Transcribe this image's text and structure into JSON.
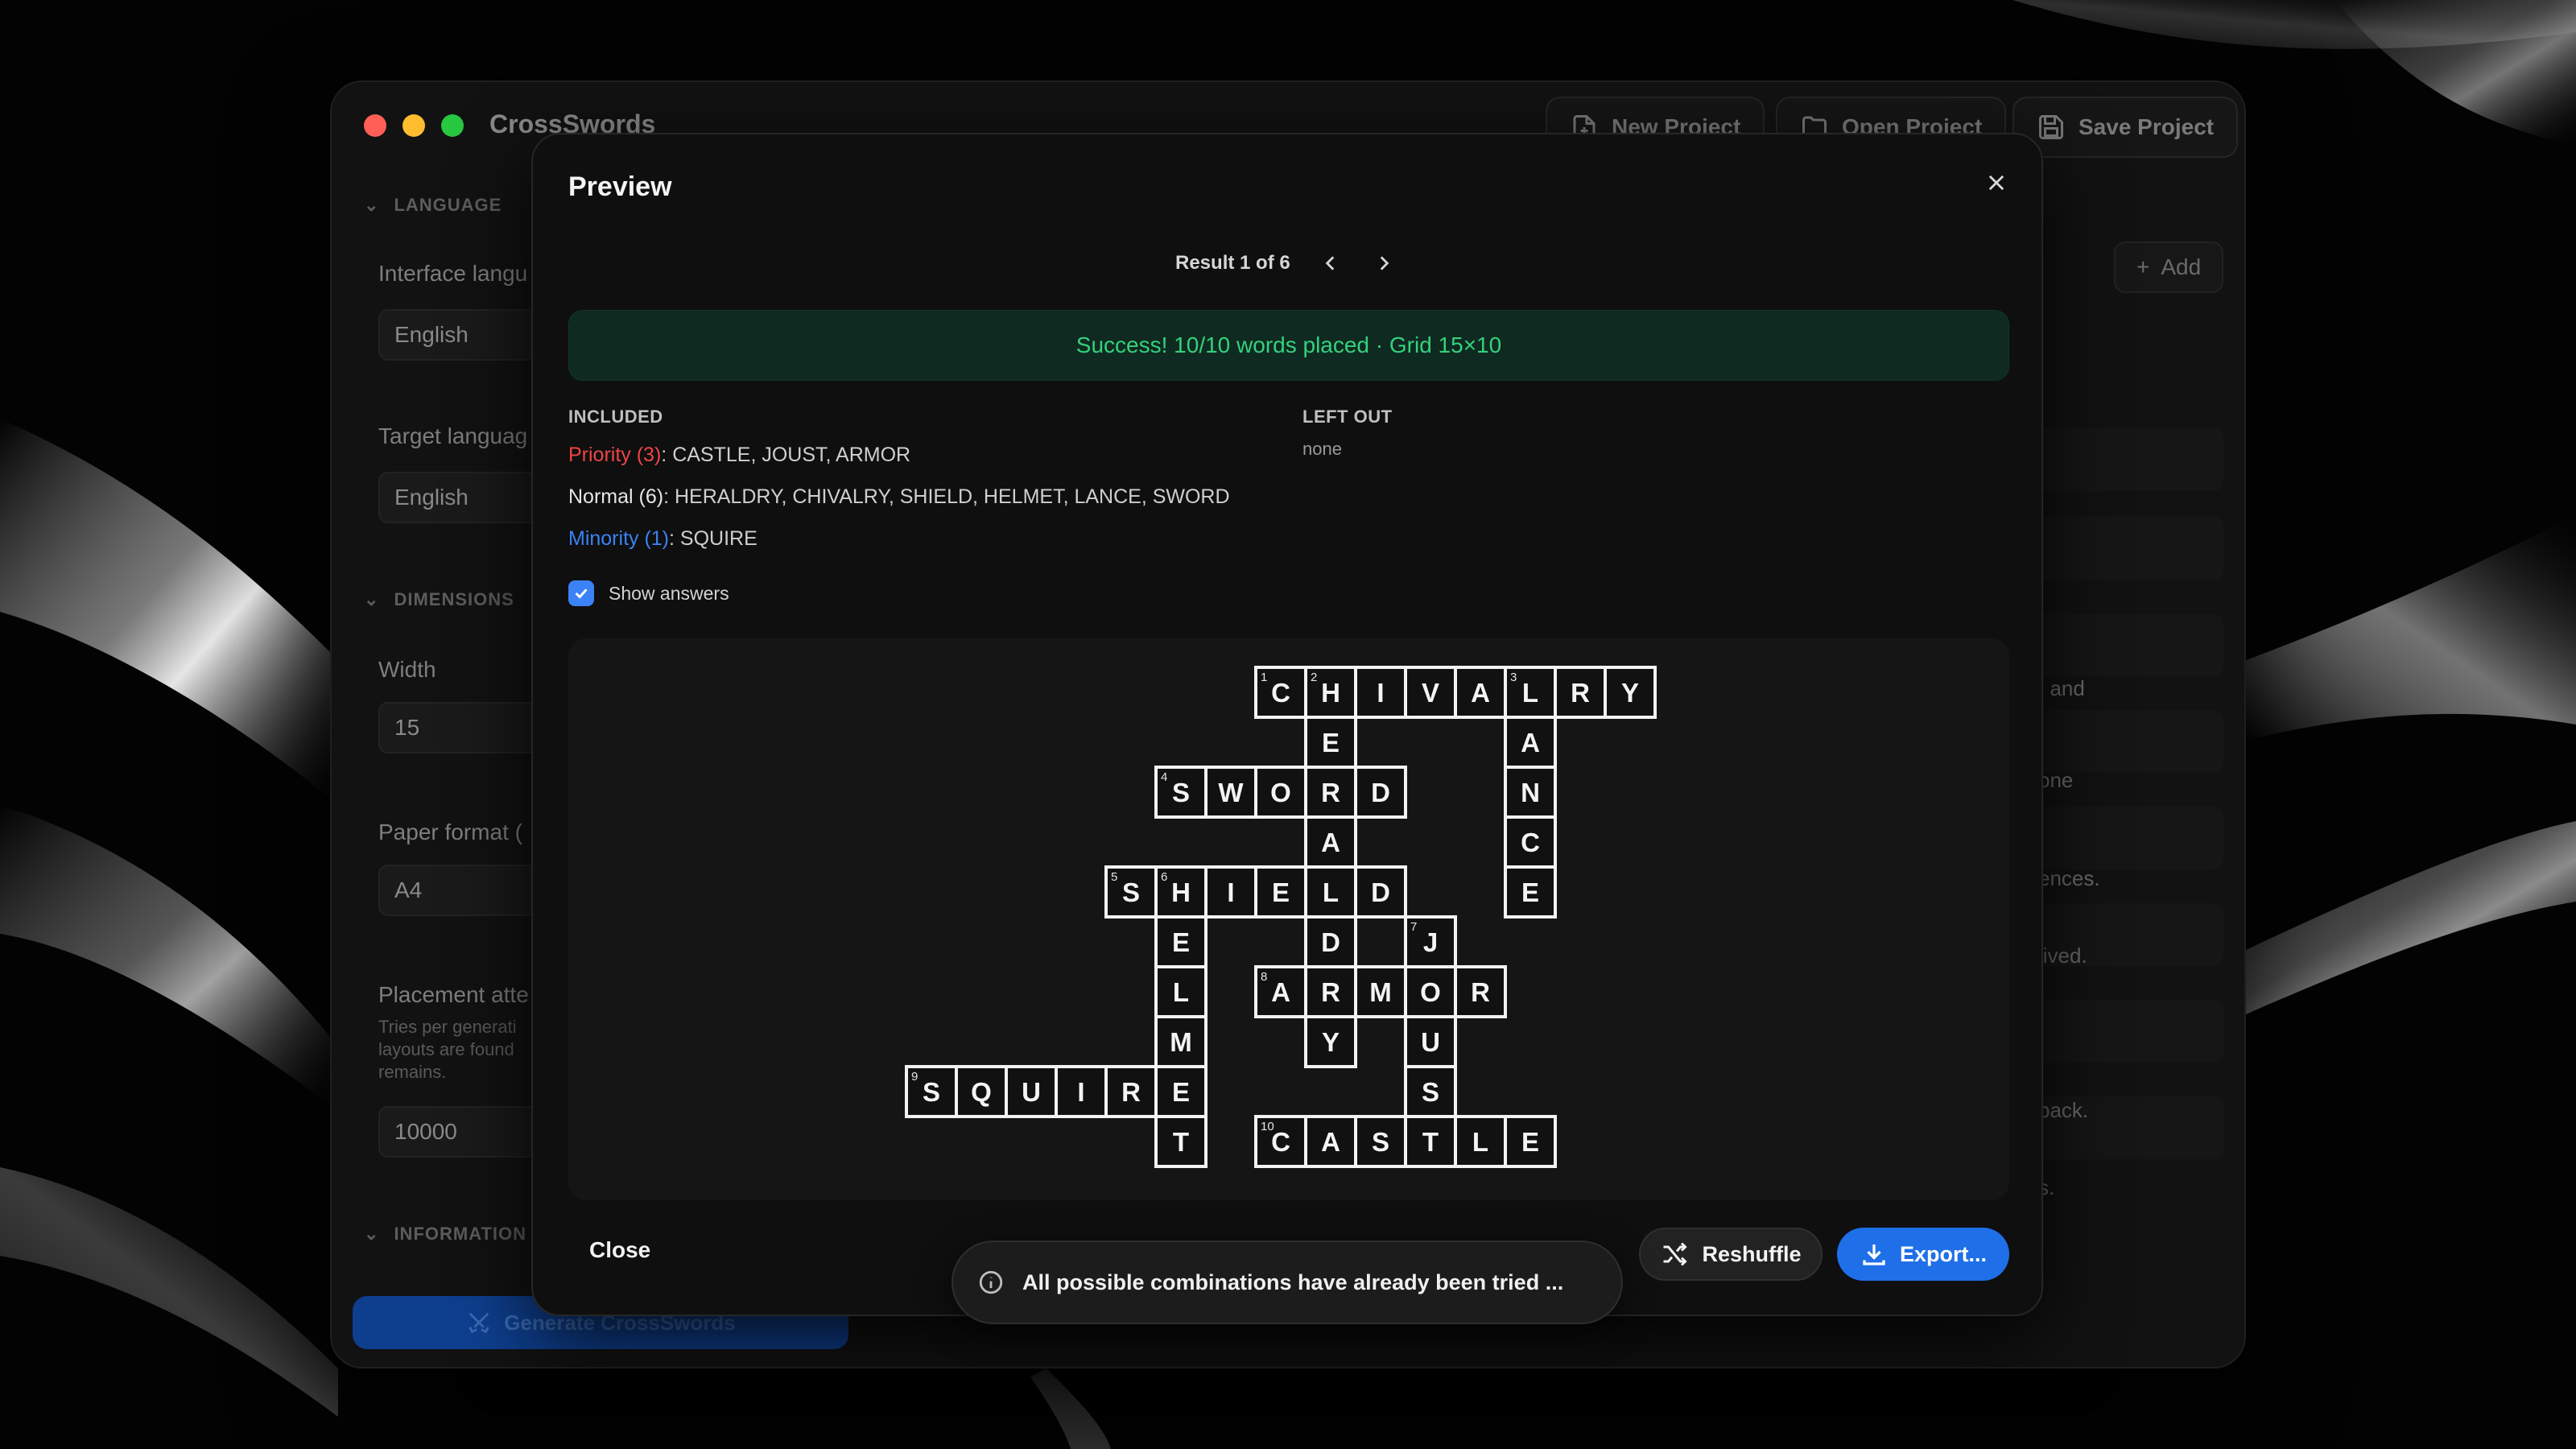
{
  "app": {
    "title": "CrossSwords",
    "toolbar": {
      "new_project": "New Project",
      "open_project": "Open Project",
      "save_project": "Save Project"
    }
  },
  "sidebar": {
    "sections": {
      "language": "LANGUAGE",
      "dimensions": "DIMENSIONS",
      "information": "INFORMATION"
    },
    "fields": {
      "interface_language_label": "Interface langu",
      "interface_language_value": "English",
      "target_language_label": "Target languag",
      "target_language_value": "English",
      "width_label": "Width",
      "width_value": "15",
      "paper_format_label": "Paper format (",
      "paper_format_value": "A4",
      "placement_label": "Placement atte",
      "placement_help": "Tries per generati layouts are found remains.",
      "placement_value": "10000"
    },
    "generate_label": "Generate CrossSwords"
  },
  "background_panel": {
    "add_label": "Add",
    "fragments": [
      ", and",
      "one",
      "ences.",
      "lived.",
      "back.",
      "s."
    ]
  },
  "modal": {
    "title": "Preview",
    "result_text": "Result 1 of 6",
    "success_text": "Success! 10/10 words placed · Grid 15×10",
    "included_heading": "INCLUDED",
    "left_out_heading": "LEFT OUT",
    "left_out_value": "none",
    "priority_label": "Priority (3)",
    "priority_words": ": CASTLE, JOUST, ARMOR",
    "normal_label": "Normal (6)",
    "normal_words": ": HERALDRY, CHIVALRY, SHIELD, HELMET, LANCE, SWORD",
    "minority_label": "Minority (1)",
    "minority_words": ": SQUIRE",
    "show_answers_label": "Show answers",
    "show_answers_checked": true,
    "close_label": "Close",
    "reshuffle_label": "Reshuffle",
    "export_label": "Export...",
    "toast_text": "All possible combinations have already been tried ..."
  },
  "crossword": {
    "grid_cols": 15,
    "grid_rows": 10,
    "words": [
      {
        "number": 1,
        "word": "CHIVALRY",
        "direction": "across",
        "row": 0,
        "col": 7
      },
      {
        "number": 2,
        "word": "HERALDRY",
        "direction": "down",
        "row": 0,
        "col": 8
      },
      {
        "number": 3,
        "word": "LANCE",
        "direction": "down",
        "row": 0,
        "col": 12
      },
      {
        "number": 4,
        "word": "SWORD",
        "direction": "across",
        "row": 2,
        "col": 5
      },
      {
        "number": 5,
        "word": "SHIELD",
        "direction": "across",
        "row": 4,
        "col": 4
      },
      {
        "number": 6,
        "word": "HELMET",
        "direction": "down",
        "row": 4,
        "col": 5
      },
      {
        "number": 7,
        "word": "JOUST",
        "direction": "down",
        "row": 5,
        "col": 10
      },
      {
        "number": 8,
        "word": "ARMOR",
        "direction": "across",
        "row": 6,
        "col": 7
      },
      {
        "number": 9,
        "word": "SQUIRE",
        "direction": "across",
        "row": 8,
        "col": 0
      },
      {
        "number": 10,
        "word": "CASTLE",
        "direction": "across",
        "row": 9,
        "col": 7
      }
    ]
  }
}
